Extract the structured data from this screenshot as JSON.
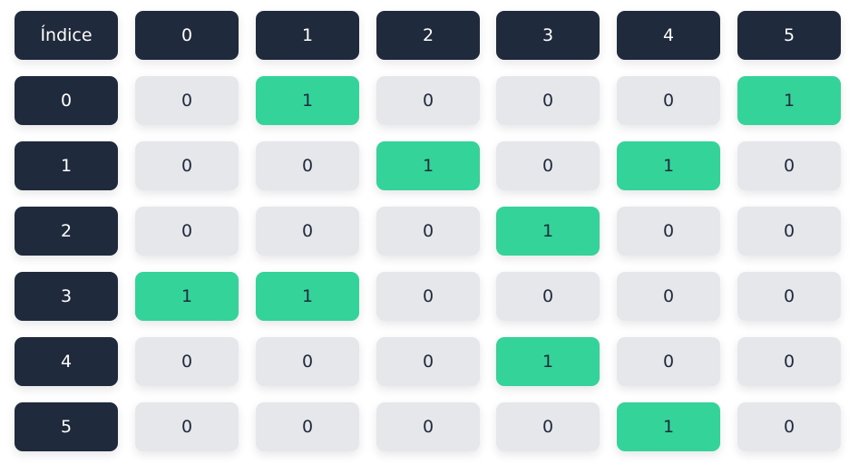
{
  "matrix": {
    "corner_label": "Índice",
    "column_headers": [
      "0",
      "1",
      "2",
      "3",
      "4",
      "5"
    ],
    "row_headers": [
      "0",
      "1",
      "2",
      "3",
      "4",
      "5"
    ],
    "rows": [
      [
        "0",
        "1",
        "0",
        "0",
        "0",
        "1"
      ],
      [
        "0",
        "0",
        "1",
        "0",
        "1",
        "0"
      ],
      [
        "0",
        "0",
        "0",
        "1",
        "0",
        "0"
      ],
      [
        "1",
        "1",
        "0",
        "0",
        "0",
        "0"
      ],
      [
        "0",
        "0",
        "0",
        "1",
        "0",
        "0"
      ],
      [
        "0",
        "0",
        "0",
        "0",
        "1",
        "0"
      ]
    ]
  },
  "colors": {
    "header_bg": "#1f2a3d",
    "zero_bg": "#e5e7eb",
    "one_bg": "#34d399",
    "text_dark": "#1f2a3d",
    "text_light": "#ffffff"
  }
}
